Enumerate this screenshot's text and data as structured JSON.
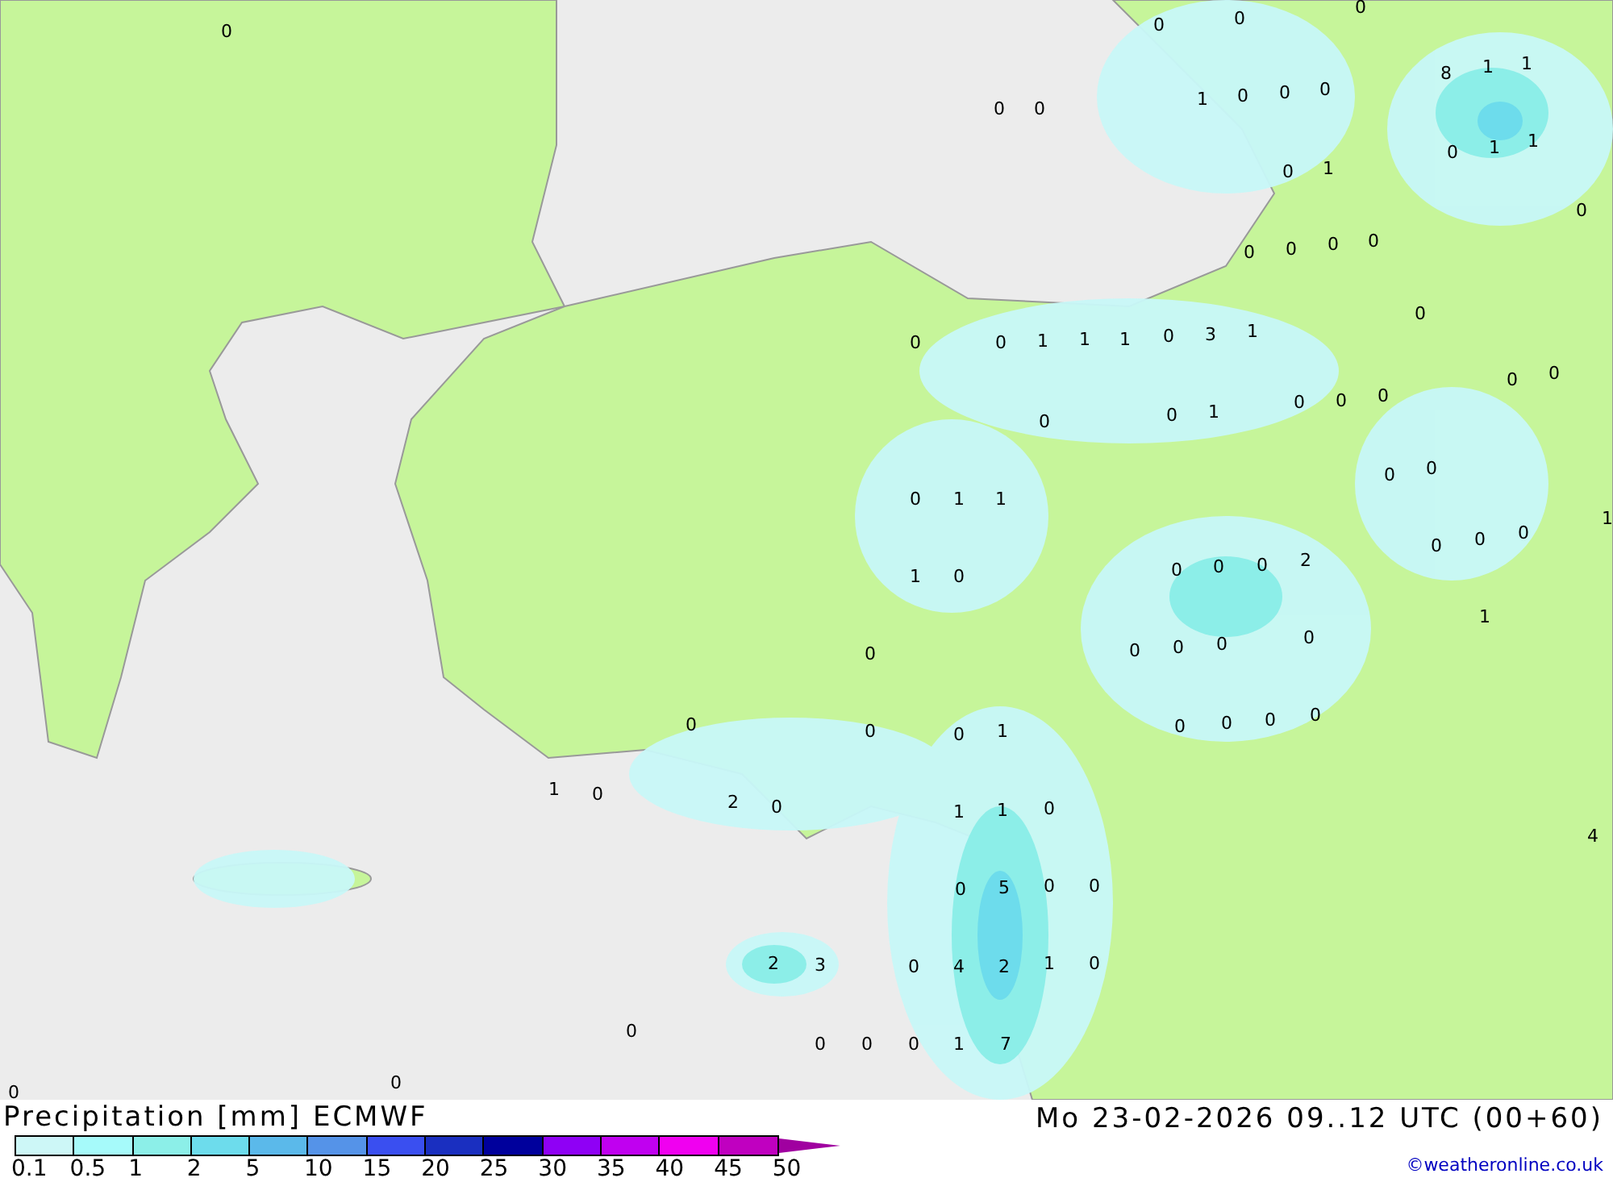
{
  "map_labels": [
    "0",
    "0",
    "0",
    "0",
    "0",
    "0",
    "1",
    "0",
    "0",
    "0",
    "8",
    "1",
    "1",
    "0",
    "1",
    "1",
    "0",
    "1",
    "0",
    "0",
    "0",
    "0",
    "0",
    "0",
    "0",
    "0",
    "1",
    "1",
    "1",
    "0",
    "3",
    "1",
    "0",
    "0",
    "0",
    "0",
    "1",
    "0",
    "0",
    "0",
    "0",
    "0",
    "0",
    "1",
    "1",
    "1",
    "0",
    "0",
    "0",
    "1",
    "0",
    "0",
    "0",
    "0",
    "2",
    "1",
    "0",
    "0",
    "0",
    "0",
    "0",
    "0",
    "0",
    "0",
    "1",
    "0",
    "0",
    "0",
    "0",
    "1",
    "0",
    "2",
    "0",
    "1",
    "1",
    "0",
    "4",
    "0",
    "5",
    "0",
    "0",
    "2",
    "3",
    "0",
    "4",
    "2",
    "1",
    "0",
    "0",
    "0",
    "0",
    "0",
    "1",
    "7",
    "0",
    "0"
  ],
  "title": "Precipitation [mm] ECMWF",
  "valid_time": "Mo 23-02-2026 09..12 UTC (00+60)",
  "legend": {
    "bins": [
      {
        "color": "#cdf7f7"
      },
      {
        "color": "#a6fafa"
      },
      {
        "color": "#8cefe8"
      },
      {
        "color": "#6ddcec"
      },
      {
        "color": "#5bb9ea"
      },
      {
        "color": "#5593e8"
      },
      {
        "color": "#3a4ff0"
      },
      {
        "color": "#1a2fc0"
      },
      {
        "color": "#00009c"
      },
      {
        "color": "#8f00f5"
      },
      {
        "color": "#c000f0"
      },
      {
        "color": "#f000f0"
      },
      {
        "color": "#c000c0"
      }
    ],
    "arrow": {
      "color": "#a000a0"
    },
    "ticks": [
      "0.1",
      "0.5",
      "1",
      "2",
      "5",
      "10",
      "15",
      "20",
      "25",
      "30",
      "35",
      "40",
      "45",
      "50"
    ]
  },
  "credit": "©weatheronline.co.uk"
}
